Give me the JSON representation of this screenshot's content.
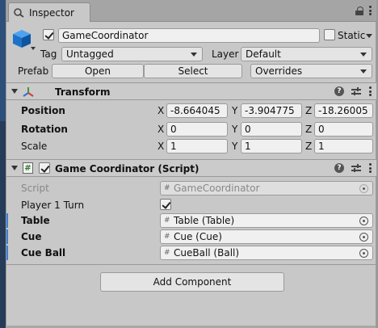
{
  "tab": {
    "title": "Inspector"
  },
  "gameobject": {
    "name": "GameCoordinator",
    "active": true,
    "static_label": "Static",
    "static_checked": false,
    "tag_label": "Tag",
    "tag_value": "Untagged",
    "layer_label": "Layer",
    "layer_value": "Default",
    "prefab_label": "Prefab",
    "prefab_open": "Open",
    "prefab_select": "Select",
    "prefab_overrides": "Overrides"
  },
  "transform": {
    "title": "Transform",
    "position_label": "Position",
    "rotation_label": "Rotation",
    "scale_label": "Scale",
    "axis_x": "X",
    "axis_y": "Y",
    "axis_z": "Z",
    "position": {
      "x": "-8.664045",
      "y": "-3.904775",
      "z": "-18.26005"
    },
    "rotation": {
      "x": "0",
      "y": "0",
      "z": "0"
    },
    "scale": {
      "x": "1",
      "y": "1",
      "z": "1"
    }
  },
  "script_component": {
    "title": "Game Coordinator (Script)",
    "enabled": true,
    "script_label": "Script",
    "script_value": "GameCoordinator",
    "fields": [
      {
        "label": "Player 1 Turn",
        "value": true
      },
      {
        "label": "Table",
        "value": "Table (Table)"
      },
      {
        "label": "Cue",
        "value": "Cue (Cue)"
      },
      {
        "label": "Cue Ball",
        "value": "CueBall (Ball)"
      }
    ]
  },
  "add_component": "Add Component",
  "icons": {
    "tab": "inspector-icon",
    "gameobject": "cube-icon",
    "transform": "transform-axes-icon",
    "script": "script-hash-icon",
    "help": "help-icon",
    "presets": "presets-icon",
    "menu": "kebab-menu-icon",
    "lock": "lock-icon",
    "target": "object-picker-icon"
  },
  "colors": {
    "accent": "#3d7ed6",
    "panel": "#c8c8c8"
  }
}
